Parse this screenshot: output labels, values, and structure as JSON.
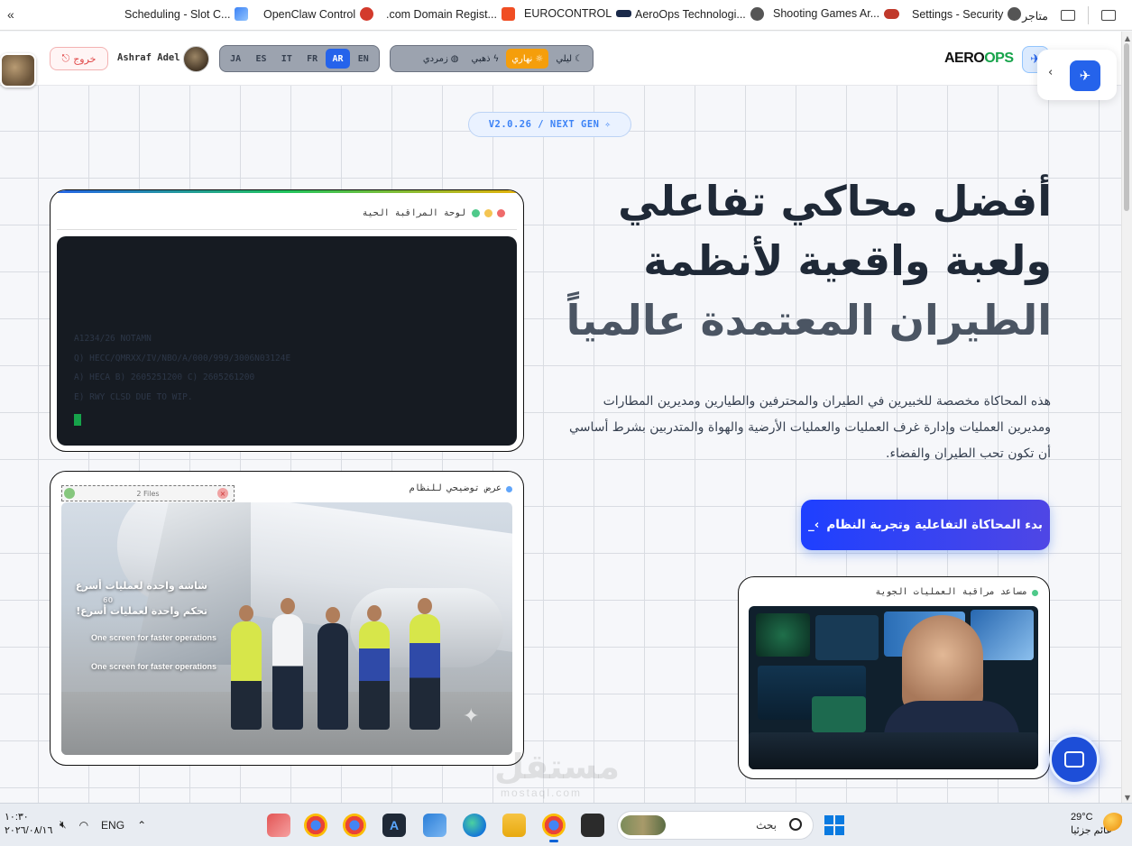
{
  "bookmarks": {
    "items": [
      {
        "label": "Scheduling - Slot C...",
        "icon": "flag-icon"
      },
      {
        "label": "OpenClaw Control",
        "icon": "claw-icon"
      },
      {
        "label": ".com Domain Regist...",
        "icon": "domain-icon"
      },
      {
        "label": "EUROCONTROL",
        "icon": "eurocontrol-icon"
      },
      {
        "label": "AeroOps Technologi...",
        "icon": "globe-icon"
      },
      {
        "label": "Shooting Games Ar...",
        "icon": "gamepad-icon"
      },
      {
        "label": "Settings - Security",
        "icon": "gear-icon"
      }
    ],
    "store_label": "متاجر"
  },
  "header": {
    "logout_label": "خروج",
    "username": "Ashraf Adel",
    "languages": [
      "JA",
      "ES",
      "IT",
      "FR",
      "AR",
      "EN"
    ],
    "active_language": "AR",
    "themes": [
      {
        "label": "ليلي",
        "icon": "moon-icon",
        "active": false
      },
      {
        "label": "نهاري",
        "icon": "sun-icon",
        "active": true
      },
      {
        "label": "ذهبي",
        "icon": "bolt-icon",
        "active": false
      },
      {
        "label": "زمردي",
        "icon": "palette-icon",
        "active": false
      }
    ],
    "brand_a": "AERO",
    "brand_b": "OPS"
  },
  "hero": {
    "version": "V2.0.26 / NEXT GEN",
    "headline_1": "أفضل محاكي تفاعلي",
    "headline_2": "ولعبة واقعية لأنظمة",
    "headline_3": "الطيران المعتمدة عالمياً",
    "description": "هذه المحاكاة مخصصة للخبيرين في الطيران والمحترفين والطيارين ومديرين المطارات ومديرين العمليات وإدارة غرف العمليات والعمليات الأرضية والهواة والمتدربين بشرط أساسي أن تكون تحب الطيران والفضاء.",
    "cta_label": "بدء المحاكاة التفاعلية وتجربة النظام"
  },
  "monitor_card": {
    "title": "لوحة المراقبة الحية",
    "lines": [
      "A1234/26 NOTAMN",
      "Q) HECC/QMRXX/IV/NBO/A/000/999/3006N03124E",
      "A) HECA B) 2605251200 C) 2605261200",
      "E) RWY CLSD DUE TO WIP."
    ]
  },
  "demo_card": {
    "title": "عرض توضيحي للنظام",
    "files_label": "2 Files",
    "overlay_ar_1": "شاشة واحدة لعمليات أسرع",
    "overlay_ar_small": "60",
    "overlay_ar_2": "تحكم واحدة لعمليات أسرع!",
    "overlay_en_1": "One screen for faster operations",
    "overlay_en_2": "One screen for faster operations"
  },
  "atc_card": {
    "title": "مساعد مراقبة العمليات الجوية"
  },
  "watermark": {
    "ar": "مستقل",
    "en": "mostaql.com"
  },
  "taskbar": {
    "time": "١٠:٣٠",
    "date": "٢٠٢٦/٠٨/١٦",
    "language": "ENG",
    "search_label": "بحث",
    "temperature": "29°C",
    "weather": "غائم جزئيا"
  },
  "colors": {
    "accent": "#2563eb",
    "brand_green": "#16a34a",
    "active_theme": "#f59e0b"
  }
}
